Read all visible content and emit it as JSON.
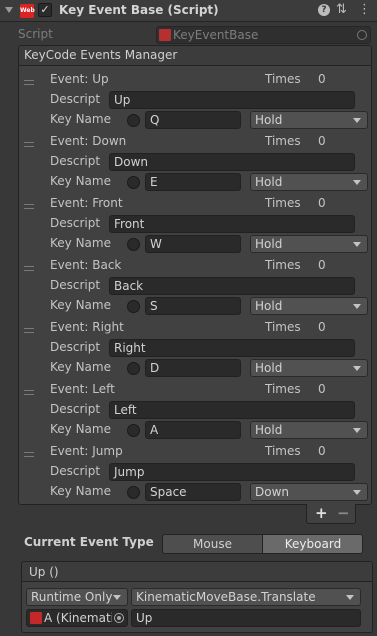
{
  "component": {
    "title": "Key Event Base (Script)",
    "icon_text": "Web",
    "enabled": "✓",
    "icons": [
      "fold-arrow-icon",
      "script-icon",
      "help-icon",
      "preset-icon",
      "context-menu-icon"
    ]
  },
  "script_field": {
    "label": "Script",
    "value": "KeyEventBase"
  },
  "events_manager": {
    "header": "KeyCode  Events  Manager",
    "labels": {
      "descript": "Descript",
      "key_name": "Key Name",
      "times": "Times"
    },
    "events": [
      {
        "event": "Event: Up",
        "times": "0",
        "descript": "Up",
        "key": "Q",
        "mode": "Hold"
      },
      {
        "event": "Event: Down",
        "times": "0",
        "descript": "Down",
        "key": "E",
        "mode": "Hold"
      },
      {
        "event": "Event: Front",
        "times": "0",
        "descript": "Front",
        "key": "W",
        "mode": "Hold"
      },
      {
        "event": "Event: Back",
        "times": "0",
        "descript": "Back",
        "key": "S",
        "mode": "Hold"
      },
      {
        "event": "Event: Right",
        "times": "0",
        "descript": "Right",
        "key": "D",
        "mode": "Hold"
      },
      {
        "event": "Event: Left",
        "times": "0",
        "descript": "Left",
        "key": "A",
        "mode": "Hold"
      },
      {
        "event": "Event: Jump",
        "times": "0",
        "descript": "Jump",
        "key": "Space",
        "mode": "Down"
      }
    ],
    "add_label": "+",
    "remove_label": "−"
  },
  "current_event_type": {
    "label": "Current Event Type",
    "options": [
      "Mouse",
      "Keyboard"
    ],
    "selected": "Keyboard"
  },
  "unity_event": {
    "header": "Up ()",
    "runtime": "Runtime Only",
    "target": "A (Kinemati",
    "method": "KinematicMoveBase.Translate",
    "argument": "Up"
  }
}
